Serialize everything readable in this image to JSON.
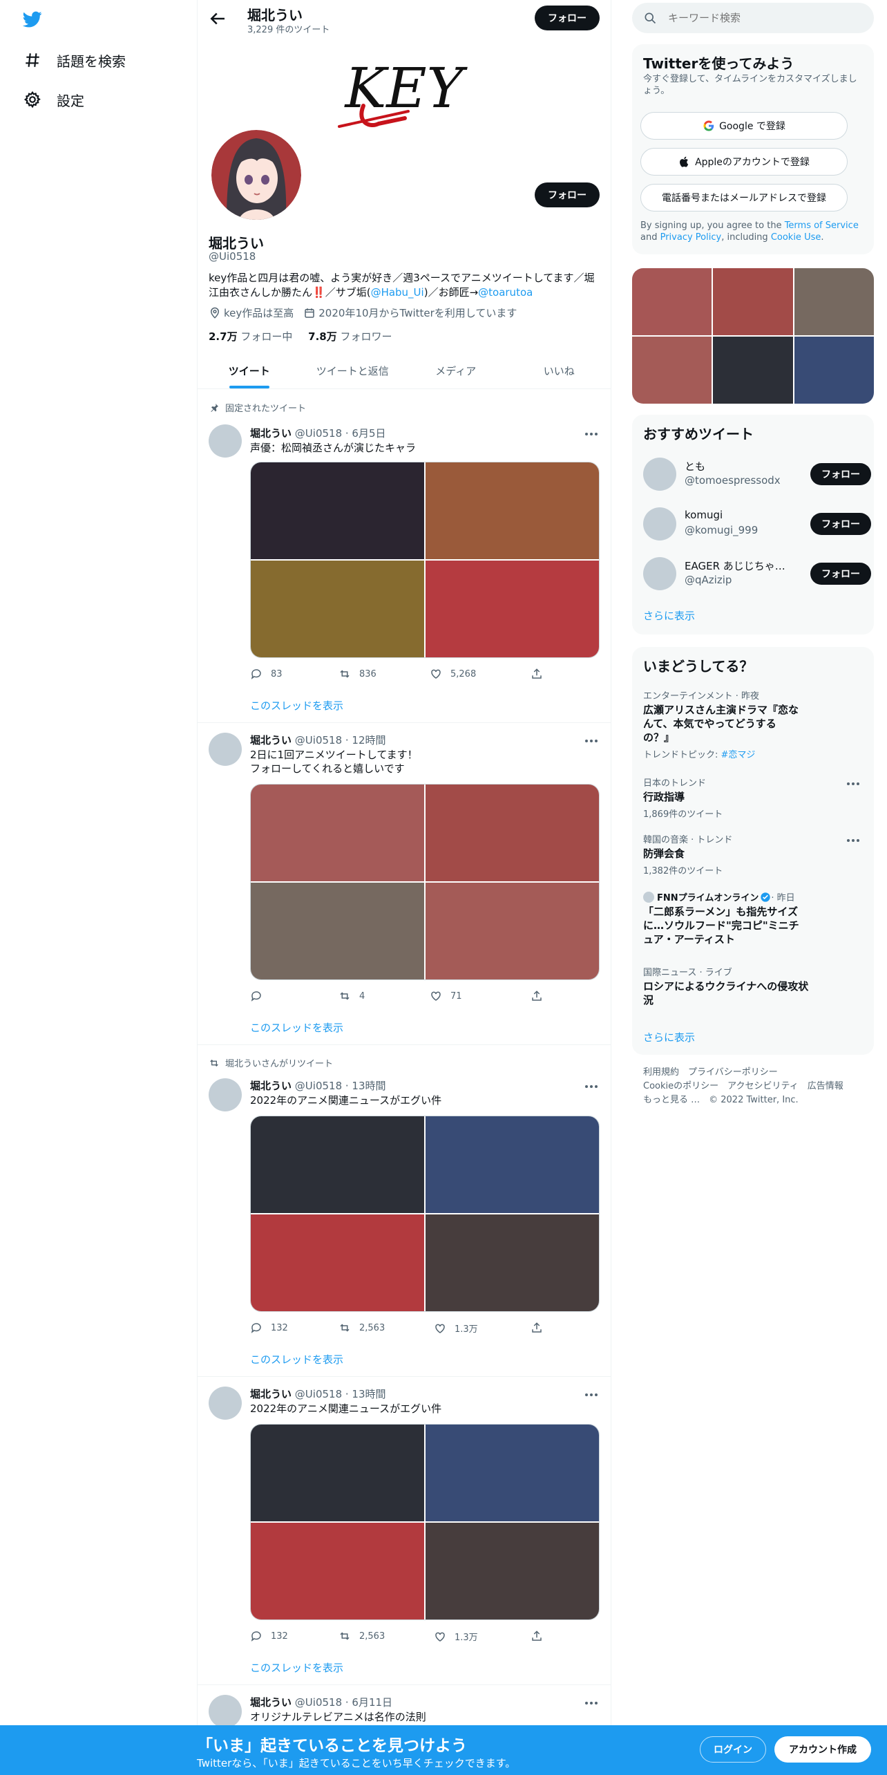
{
  "nav": {
    "explore_label": "話題を検索",
    "settings_label": "設定"
  },
  "header": {
    "name": "堀北うい",
    "tweet_count": "3,229 件のツイート",
    "follow_label": "フォロー"
  },
  "profile": {
    "banner_text": "KEY",
    "name": "堀北うい",
    "handle": "@Ui0518",
    "follow_label": "フォロー",
    "bio_part1": "key作品と四月は君の嘘、よう実が好き／週3ペースでアニメツイートしてます／堀江由衣さんしか勝たん",
    "bio_emoji": "‼️",
    "bio_part2": "／サブ垢(",
    "bio_link1": "@Habu_Ui",
    "bio_part3": ")／お師匠→",
    "bio_link2": "@toarutoa",
    "location": "key作品は至高",
    "joined": "2020年10月からTwitterを利用しています",
    "following_count": "2.7万",
    "following_label": "フォロー中",
    "followers_count": "7.8万",
    "followers_label": "フォロワー"
  },
  "tabs": [
    "ツイート",
    "ツイートと返信",
    "メディア",
    "いいね"
  ],
  "tweets": [
    {
      "context": "固定されたツイート",
      "name": "堀北うい",
      "meta": "@Ui0518 · 6月5日",
      "text": "声優：松岡禎丞さんが演じたキャラ",
      "images": [
        "#2b2530",
        "#9a5a3a",
        "#866b2f",
        "#b53b40"
      ],
      "replies": "83",
      "retweets": "836",
      "likes": "5,268",
      "thread_label": "このスレッドを表示"
    },
    {
      "context": "",
      "name": "堀北うい",
      "meta": "@Ui0518 · 12時間",
      "text": "2日に1回アニメツイートしてます！\nフォローしてくれると嬉しいです",
      "images": [
        "#a55a58",
        "#a24b48",
        "#766960",
        "#a45b57"
      ],
      "replies": "",
      "retweets": "4",
      "likes": "71",
      "thread_label": "このスレッドを表示"
    },
    {
      "context": "堀北ういさんがリツイート",
      "name": "堀北うい",
      "meta": "@Ui0518 · 13時間",
      "text": "2022年のアニメ関連ニュースがエグい件",
      "images": [
        "#2c2f37",
        "#384b75",
        "#b23a3e",
        "#473d3d"
      ],
      "replies": "132",
      "retweets": "2,563",
      "likes": "1.3万",
      "thread_label": "このスレッドを表示"
    },
    {
      "context": "",
      "name": "堀北うい",
      "meta": "@Ui0518 · 13時間",
      "text": "2022年のアニメ関連ニュースがエグい件",
      "images": [
        "#2c2f37",
        "#384b75",
        "#b23a3e",
        "#473d3d"
      ],
      "replies": "132",
      "retweets": "2,563",
      "likes": "1.3万",
      "thread_label": "このスレッドを表示"
    },
    {
      "context": "",
      "name": "堀北うい",
      "meta": "@Ui0518 · 6月11日",
      "text": "オリジナルテレビアニメは名作の法則"
    }
  ],
  "search": {
    "placeholder": "キーワード検索"
  },
  "signup": {
    "title": "Twitterを使ってみよう",
    "desc": "今すぐ登録して、タイムラインをカスタマイズしましょう。",
    "google_label": "Google で登録",
    "apple_label": "Appleのアカウントで登録",
    "email_label": "電話番号またはメールアドレスで登録",
    "legal_pre": "By signing up, you agree to the ",
    "terms": "Terms of Service",
    "legal_and": " and ",
    "privacy": "Privacy Policy",
    "legal_including": ", including ",
    "cookie": "Cookie Use",
    "legal_end": "."
  },
  "media_grid": [
    "#a65655",
    "#a24b48",
    "#766960",
    "#a45b57",
    "#2c2f37",
    "#384b75"
  ],
  "suggestions": {
    "title": "おすすめツイート",
    "items": [
      {
        "name": "とも",
        "handle": "@tomoespressodx",
        "button": "フォロー"
      },
      {
        "name": "komugi",
        "handle": "@komugi_999",
        "button": "フォロー"
      },
      {
        "name": "EAGER あじじちゃ…",
        "handle": "@qAzizip",
        "button": "フォロー"
      }
    ],
    "more": "さらに表示"
  },
  "trends": {
    "title": "いまどうしてる？",
    "items": [
      {
        "category": "エンターテインメント · 昨夜",
        "title": "広瀬アリスさん主演ドラマ『恋なんて、本気でやってどうするの？』",
        "sub_label": "トレンドトピック: ",
        "sub_link": "#恋マジ"
      },
      {
        "category": "日本のトレンド",
        "title": "行政指導",
        "sub": "1,869件のツイート"
      },
      {
        "category": "韓国の音楽 · トレンド",
        "title": "防弾会食",
        "sub": "1,382件のツイート"
      },
      {
        "source": "FNNプライムオンライン",
        "time": " · 昨日",
        "title": "「二郎系ラーメン」も指先サイズに…ソウルフード\"完コピ\"ミニチュア・アーティスト"
      },
      {
        "category": "国際ニュース · ライブ",
        "title": "ロシアによるウクライナへの侵攻状況"
      }
    ],
    "more": "さらに表示"
  },
  "footer": {
    "line1": "利用規約　プライバシーポリシー",
    "line2": "Cookieのポリシー　アクセシビリティ　広告情報",
    "line3": "もっと見る …　© 2022 Twitter, Inc."
  },
  "bottom_bar": {
    "title": "「いま」起きていることを見つけよう",
    "subtitle": "Twitterなら、「いま」起きていることをいち早くチェックできます。",
    "login": "ログイン",
    "signup": "アカウント作成"
  },
  "colors": {
    "accent": "#1d9bf0",
    "text": "#0f1419",
    "secondary": "#536471",
    "bottom_bar": "#1d9bf0"
  }
}
